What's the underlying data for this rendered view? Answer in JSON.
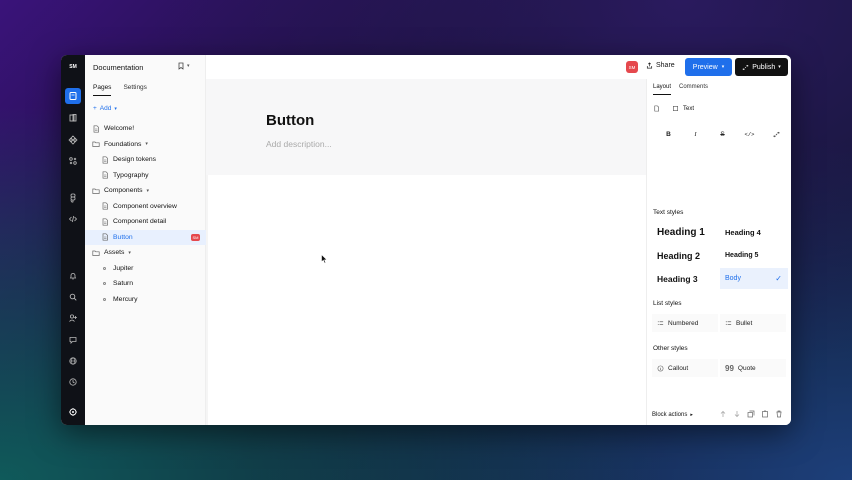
{
  "workspace": {
    "initials": "SM"
  },
  "header": {
    "doc_name": "Documentation",
    "avatar_initials": "SM",
    "share_label": "Share",
    "preview_label": "Preview",
    "publish_label": "Publish"
  },
  "sidebar": {
    "tabs": [
      "Pages",
      "Settings"
    ],
    "add_label": "Add",
    "tree": [
      {
        "label": "Welcome!",
        "icon": "page-icon",
        "level": 0
      },
      {
        "label": "Foundations",
        "icon": "folder-icon",
        "level": 0,
        "expand": true
      },
      {
        "label": "Design tokens",
        "icon": "page-icon",
        "level": 1
      },
      {
        "label": "Typography",
        "icon": "page-icon",
        "level": 1
      },
      {
        "label": "Components",
        "icon": "folder-icon",
        "level": 0,
        "expand": true
      },
      {
        "label": "Component overview",
        "icon": "page-icon",
        "level": 1
      },
      {
        "label": "Component detail",
        "icon": "page-icon",
        "level": 1
      },
      {
        "label": "Button",
        "icon": "page-icon",
        "level": 1,
        "selected": true,
        "badge": "SM"
      },
      {
        "label": "Assets",
        "icon": "folder-icon",
        "level": 0,
        "expand": true
      },
      {
        "label": "Jupiter",
        "icon": "dot-icon",
        "level": 1
      },
      {
        "label": "Saturn",
        "icon": "dot-icon",
        "level": 1
      },
      {
        "label": "Mercury",
        "icon": "dot-icon",
        "level": 1
      }
    ]
  },
  "document": {
    "title": "Button",
    "description_placeholder": "Add description..."
  },
  "panel": {
    "tabs": [
      "Layout",
      "Comments"
    ],
    "block_type_label": "Text",
    "text_styles_label": "Text styles",
    "text_styles": [
      "Heading 1",
      "Heading 4",
      "Heading 2",
      "Heading 5",
      "Heading 3",
      "Body"
    ],
    "list_styles_label": "List styles",
    "list_styles": [
      "Numbered",
      "Bullet"
    ],
    "other_styles_label": "Other styles",
    "other_styles": [
      "Callout",
      "Quote"
    ],
    "block_actions_label": "Block actions"
  },
  "colors": {
    "accent": "#1f6feb",
    "badge": "#e5484d",
    "dark": "#111111"
  }
}
